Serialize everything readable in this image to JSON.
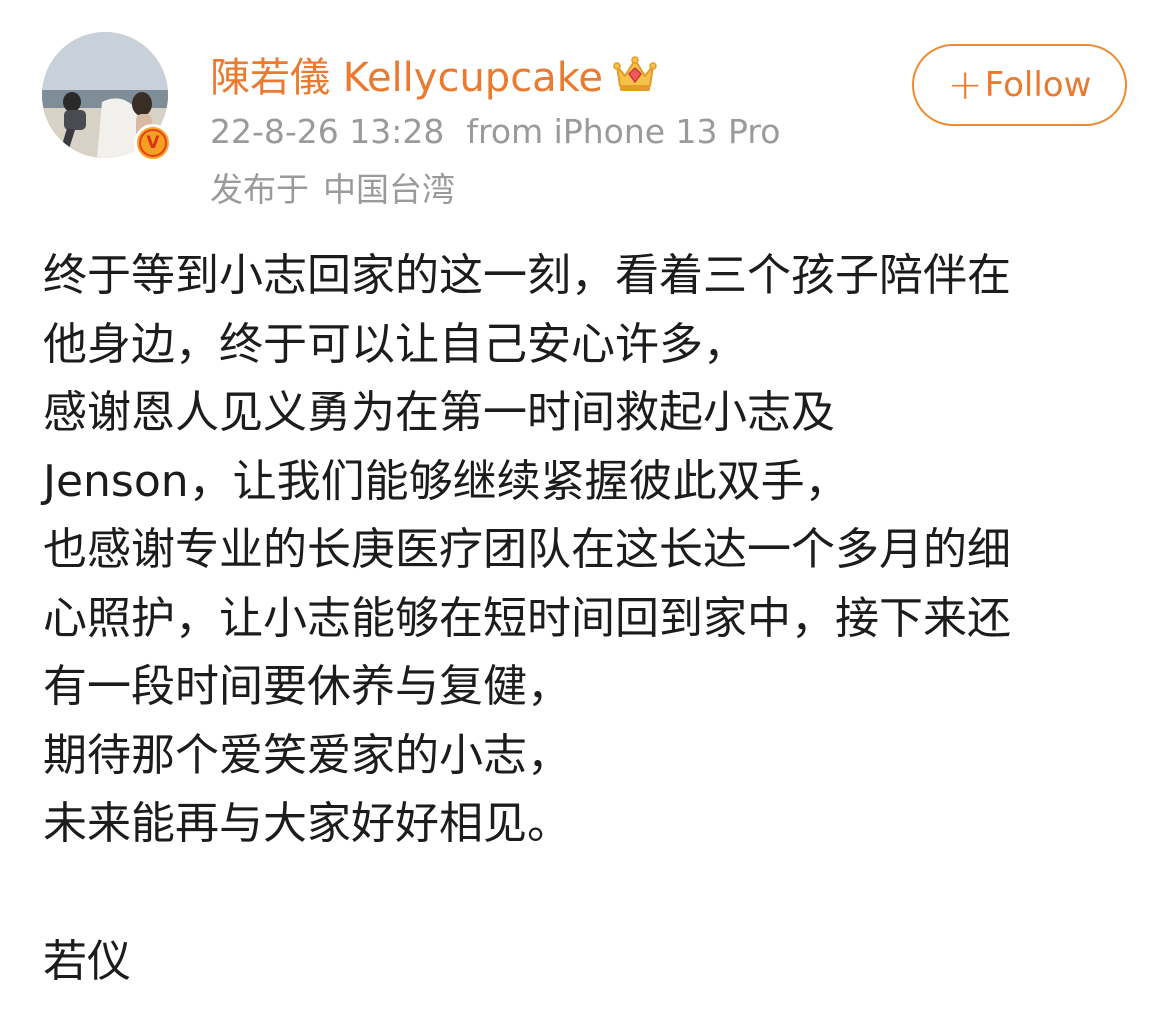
{
  "post": {
    "author": {
      "name": "陳若儀 Kellycupcake",
      "verified": true,
      "verified_badge_text": "V",
      "member_icon": "crown-icon"
    },
    "timestamp": "22-8-26 13:28",
    "source": "from iPhone 13 Pro",
    "location_prefix": "发布于",
    "location": "中国台湾",
    "follow_button": {
      "label": "Follow",
      "icon": "plus-icon"
    },
    "body_lines": [
      "终于等到小志回家的这一刻，看着三个孩子陪伴在",
      "他身边，终于可以让自己安心许多，",
      "感谢恩人见义勇为在第一时间救起小志及",
      "Jenson，让我们能够继续紧握彼此双手，",
      "也感谢专业的长庚医疗团队在这长达一个多月的细",
      "心照护，让小志能够在短时间回到家中，接下来还",
      "有一段时间要休养与复健，",
      "期待那个爱笑爱家的小志，",
      "未来能再与大家好好相见。"
    ],
    "signature": "若仪"
  },
  "colors": {
    "accent": "#ea7a2f",
    "meta_text": "#9a9a9a",
    "body_text": "#1c1c1c",
    "badge": "#f5a623"
  }
}
